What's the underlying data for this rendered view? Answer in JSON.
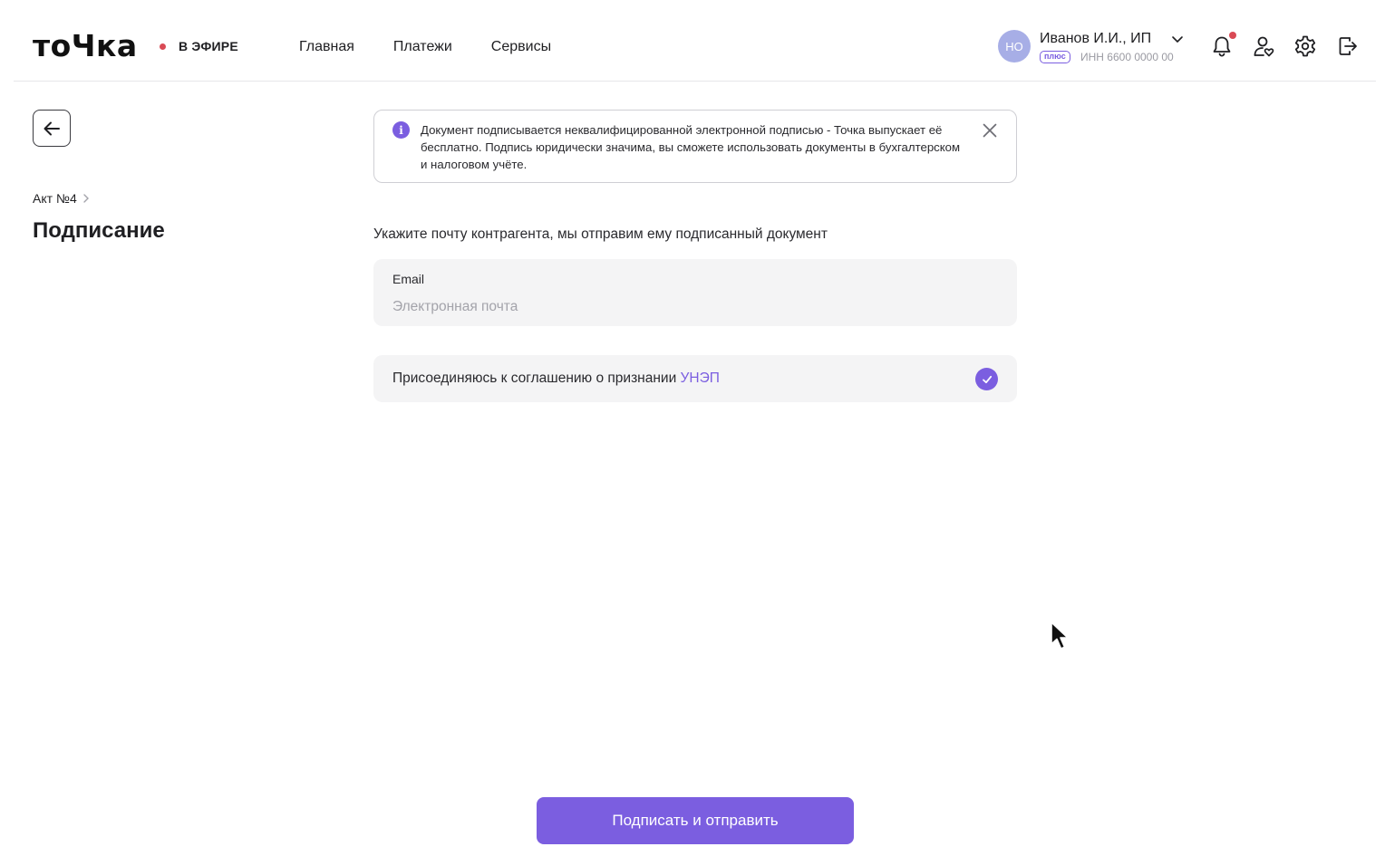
{
  "header": {
    "logo": "тоЧка",
    "live_label": "В ЭФИРЕ",
    "nav": [
      "Главная",
      "Платежи",
      "Сервисы"
    ],
    "user": {
      "avatar_initials": "НО",
      "name": "Иванов И.И., ИП",
      "badge": "плюс",
      "inn": "ИНН 6600 0000 00"
    },
    "icons": [
      "bell-icon",
      "profile-heart-icon",
      "gear-icon",
      "logout-icon"
    ]
  },
  "sidebar": {
    "breadcrumb": "Акт №4",
    "title": "Подписание"
  },
  "info": {
    "text": "Документ подписывается неквалифицированной электронной подписью - Точка выпускает её бесплатно. Подпись юридически значима, вы сможете использовать документы в бухгалтерском и налоговом учёте."
  },
  "form": {
    "hint": "Укажите почту контрагента, мы отправим ему подписанный документ",
    "email_label": "Email",
    "email_placeholder": "Электронная почта",
    "email_value": "",
    "agreement_text": "Присоединяюсь к соглашению о признании",
    "agreement_link": "УНЭП",
    "agreement_checked": true
  },
  "submit_label": "Подписать и отправить",
  "colors": {
    "accent": "#7b5ee0",
    "notification": "#d94a55",
    "avatar_bg": "#a7aee6",
    "field_bg": "#f4f4f5"
  }
}
